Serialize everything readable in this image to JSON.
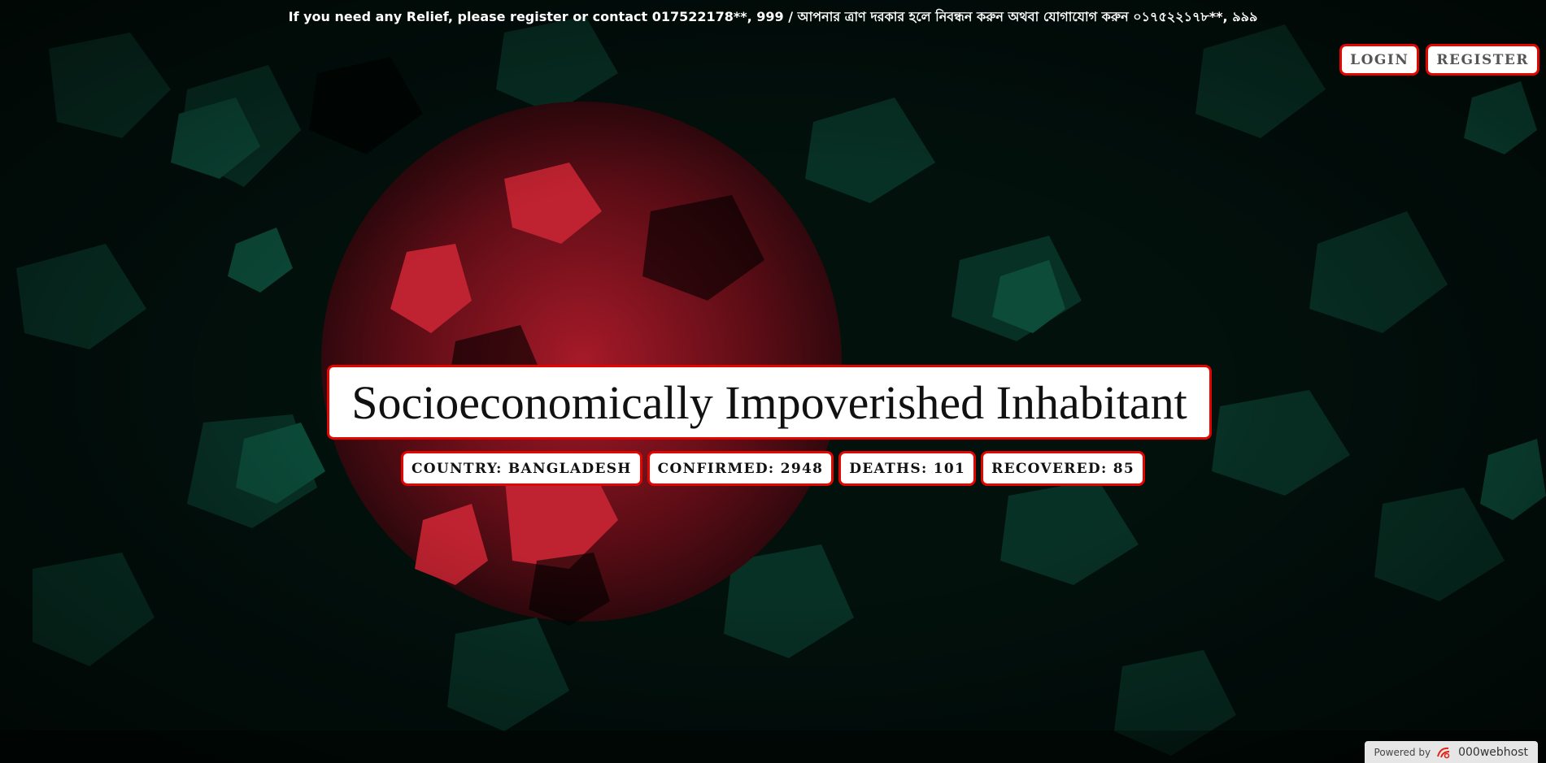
{
  "notice": "If you need any Relief, please register or contact 017522178**, 999 / আপনার ত্রাণ দরকার হলে নিবন্ধন করুন অথবা যোগাযোগ করুন ০১৭৫২২১৭৮**, ৯৯৯",
  "auth": {
    "login": "LOGIN",
    "register": "REGISTER"
  },
  "hero": {
    "title": "Socioeconomically Impoverished Inhabitant"
  },
  "stats": {
    "country": "COUNTRY: BANGLADESH",
    "confirmed": "CONFIRMED: 2948",
    "deaths": "DEATHS: 101",
    "recovered": "RECOVERED: 85"
  },
  "footer": {
    "powered_by": "Powered by",
    "host": "000webhost",
    "icon": "000webhost-logo-icon"
  },
  "colors": {
    "accent_border": "#e10600",
    "flag_green": "#006a4e",
    "flag_red": "#f42a41",
    "button_text": "#555555"
  }
}
